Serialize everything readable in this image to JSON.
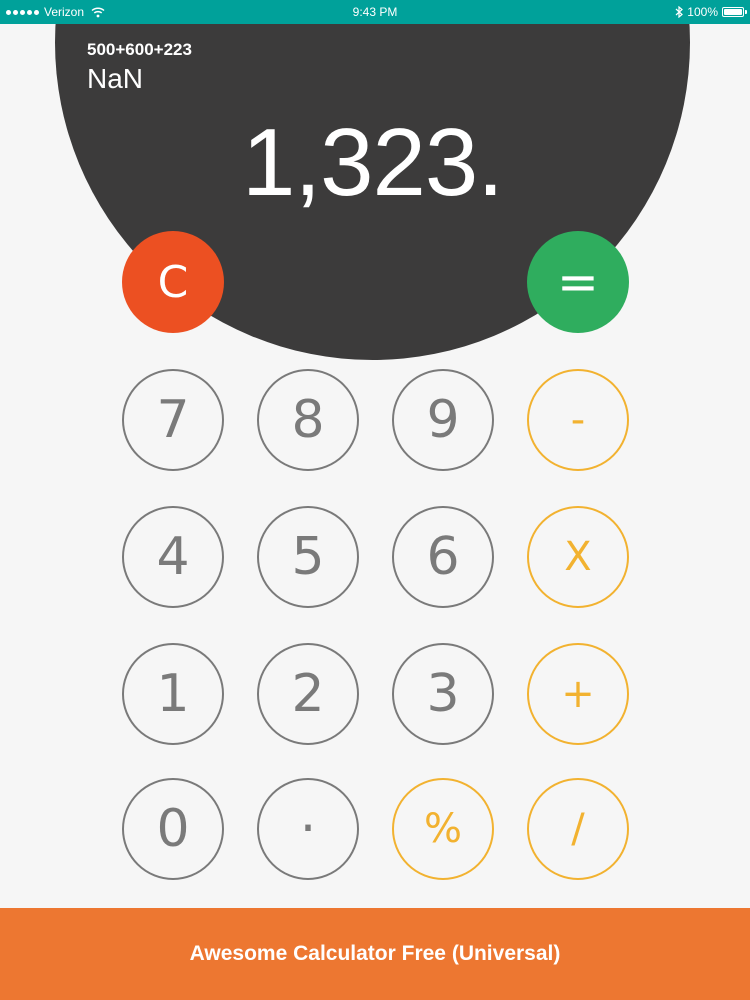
{
  "status_bar": {
    "carrier": "Verizon",
    "time": "9:43 PM",
    "battery": "100%",
    "icons": [
      "signal-dots-icon",
      "wifi-icon",
      "bluetooth-icon",
      "battery-icon"
    ]
  },
  "display": {
    "expression": "500+600+223",
    "previous_result": "NaN",
    "result": "1,323."
  },
  "keys": {
    "clear": "C",
    "equals": "=",
    "seven": "7",
    "eight": "8",
    "nine": "9",
    "minus": "-",
    "four": "4",
    "five": "5",
    "six": "6",
    "multiply": "X",
    "one": "1",
    "two": "2",
    "three": "3",
    "plus": "+",
    "zero": "0",
    "decimal": "·",
    "percent": "%",
    "divide": "/"
  },
  "banner": {
    "text": "Awesome Calculator Free (Universal)"
  },
  "colors": {
    "status_bar": "#00a19a",
    "display": "#3c3b3b",
    "clear": "#ec5022",
    "equals": "#2fad5e",
    "digit": "#7a7a7a",
    "operator": "#f2b230",
    "banner": "#ed7731",
    "background": "#f6f6f6"
  }
}
